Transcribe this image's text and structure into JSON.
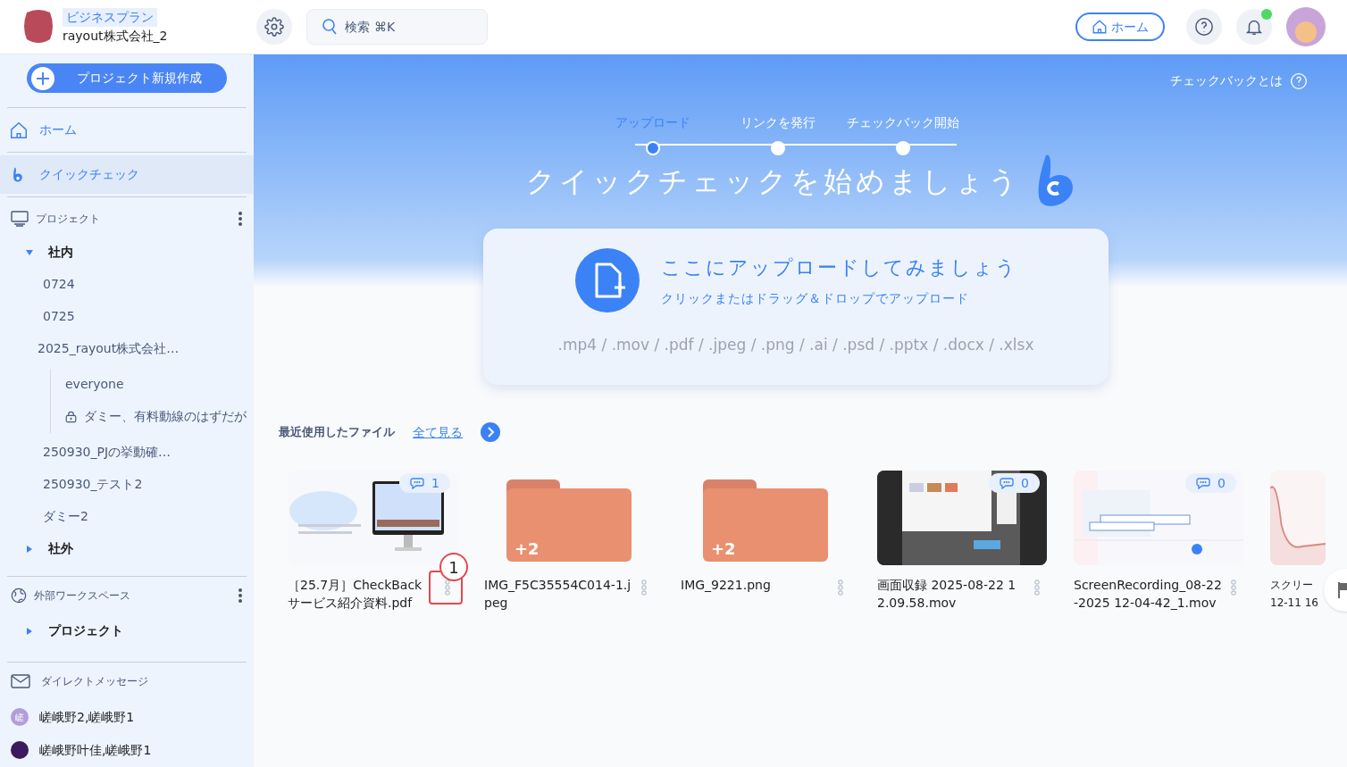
{
  "header": {
    "plan": "ビジネスプラン",
    "company": "rayout株式会社_2",
    "search": {
      "placeholder": "検索 ⌘K"
    },
    "home_button": "ホーム",
    "notification_dot": true
  },
  "sidebar": {
    "new_project": "プロジェクト新規作成",
    "nav": [
      {
        "kind": "home",
        "label": "ホーム",
        "selected": false
      },
      {
        "kind": "quick",
        "label": "クイックチェック",
        "selected": true
      }
    ],
    "projects": {
      "title": "プロジェクト",
      "groups": [
        {
          "label": "社内",
          "expanded": true,
          "children": [
            {
              "label": "0724"
            },
            {
              "label": "0725"
            },
            {
              "label": "2025_rayout株式会社…",
              "children": [
                {
                  "label": "everyone",
                  "locked": false
                },
                {
                  "label": "ダミー、有料動線のはずだが",
                  "locked": true
                }
              ]
            },
            {
              "label": "250930_PJの挙動確…"
            },
            {
              "label": "250930_テスト2"
            },
            {
              "label": "ダミー2"
            }
          ]
        },
        {
          "label": "社外",
          "expanded": false
        }
      ]
    },
    "external": {
      "title": "外部ワークスペース",
      "groups": [
        {
          "label": "プロジェクト",
          "expanded": false
        }
      ]
    },
    "messages": {
      "title": "ダイレクトメッセージ",
      "items": [
        {
          "name": "嵯峨野2,嵯峨野1",
          "avatar": "嵯",
          "color": "#b39ddb"
        },
        {
          "name": "嵯峨野叶佳,嵯峨野1",
          "color": "#3b1b5e"
        }
      ]
    }
  },
  "main": {
    "help_link": "チェックバックとは",
    "steps": [
      {
        "label": "アップロード",
        "selected": true
      },
      {
        "label": "リンクを発行",
        "selected": false
      },
      {
        "label": "チェックバック開始",
        "selected": false
      }
    ],
    "title": "クイックチェックを始めましょう",
    "upload": {
      "title": "ここにアップロードしてみましょう",
      "subtitle": "クリックまたはドラッグ＆ドロップでアップロード",
      "formats": ".mp4 / .mov / .pdf / .jpeg / .png / .ai / .psd / .pptx / .docx / .xlsx"
    },
    "recent": {
      "title": "最近使用したファイル",
      "see_all": "全て見る",
      "files": [
        {
          "kind": "document",
          "comments": "1",
          "name": "［25.7月］CheckBack サービス紹介資料.pdf",
          "annotation": "1"
        },
        {
          "kind": "folder",
          "count": "+2",
          "name": "IMG_F5C35554C014-1.jpeg"
        },
        {
          "kind": "folder",
          "count": "+2",
          "name": "IMG_9221.png"
        },
        {
          "kind": "video",
          "comments": "0",
          "name": "画面収録 2025-08-22 12.09.58.mov"
        },
        {
          "kind": "calendar",
          "comments": "0",
          "name": "ScreenRecording_08-22-2025 12-04-42_1.mov"
        },
        {
          "kind": "chart",
          "name": "スクリー 12-11 16"
        }
      ]
    }
  }
}
